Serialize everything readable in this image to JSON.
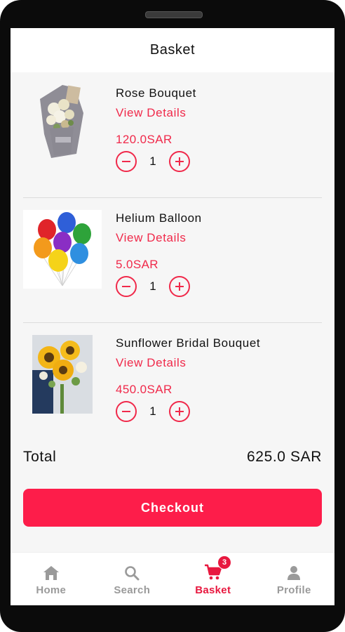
{
  "header": {
    "title": "Basket"
  },
  "items": [
    {
      "name": "Rose Bouquet",
      "link": "View Details",
      "price": "120.0SAR",
      "qty": "1",
      "image": "rose-bouquet"
    },
    {
      "name": "Helium Balloon",
      "link": "View Details",
      "price": "5.0SAR",
      "qty": "1",
      "image": "helium-balloons"
    },
    {
      "name": "Sunflower Bridal Bouquet",
      "link": "View Details",
      "price": "450.0SAR",
      "qty": "1",
      "image": "sunflower-bouquet"
    }
  ],
  "summary": {
    "total_label": "Total",
    "total_value": "625.0 SAR"
  },
  "checkout": {
    "label": "Checkout"
  },
  "tabbar": {
    "tabs": [
      {
        "label": "Home",
        "icon": "home-icon"
      },
      {
        "label": "Search",
        "icon": "search-icon"
      },
      {
        "label": "Basket",
        "icon": "cart-icon",
        "badge": "3",
        "active": true
      },
      {
        "label": "Profile",
        "icon": "profile-icon"
      }
    ]
  },
  "colors": {
    "accent": "#f0294a",
    "button": "#fd1d4a",
    "inactive": "#9a9a9a"
  }
}
